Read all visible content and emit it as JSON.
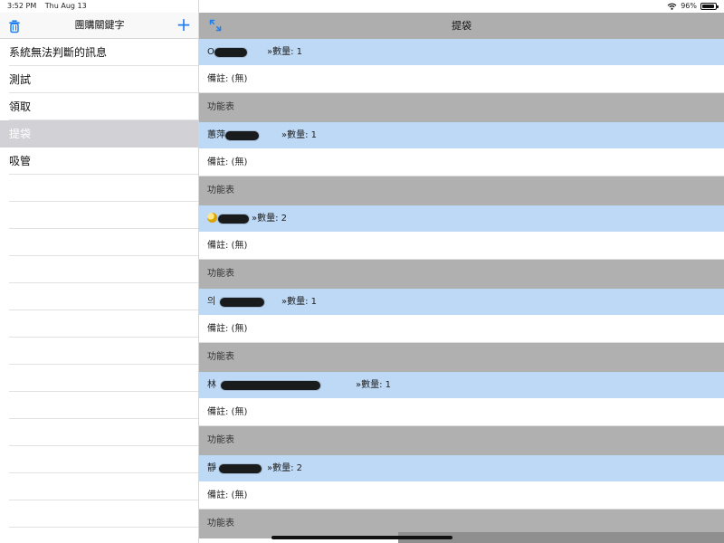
{
  "status_bar": {
    "time": "3:52 PM",
    "date": "Thu Aug 13",
    "battery": "96%",
    "icons": [
      "wifi-icon",
      "battery-icon"
    ]
  },
  "sidebar": {
    "title": "團購關鍵字",
    "icons": {
      "delete": "trash-icon",
      "add": "plus-icon"
    },
    "add_label": "+",
    "items": [
      {
        "label": "系統無法判斷的訊息",
        "selected": false
      },
      {
        "label": "測試",
        "selected": false
      },
      {
        "label": "領取",
        "selected": false
      },
      {
        "label": "提袋",
        "selected": true
      },
      {
        "label": "吸管",
        "selected": false
      }
    ]
  },
  "main": {
    "title": "提袋",
    "expand_icon": "expand-icon",
    "records": [
      {
        "name": "O",
        "quantity": "»數量: 1",
        "note": "備註: (無)",
        "menu": "功能表"
      },
      {
        "name": "蕙萍",
        "quantity": "»數量: 1",
        "note": "備註: (無)",
        "menu": "功能表"
      },
      {
        "name": "",
        "quantity": "»數量: 2",
        "note": "備註: (無)",
        "menu": "功能表",
        "emoji": true
      },
      {
        "name": "의",
        "quantity": "»數量: 1",
        "note": "備註: (無)",
        "menu": "功能表"
      },
      {
        "name": "林",
        "quantity": "»數量: 1",
        "note": "備註: (無)",
        "menu": "功能表"
      },
      {
        "name": "靜",
        "quantity": "»數量: 2",
        "note": "備註: (無)",
        "menu": "功能表"
      }
    ]
  },
  "colors": {
    "accent": "#1f7ef0",
    "selected_row": "#d2d1d6",
    "item_row": "#bdd9f6",
    "menu_row": "#b0b0b0",
    "header_bar": "#aeaeae"
  }
}
